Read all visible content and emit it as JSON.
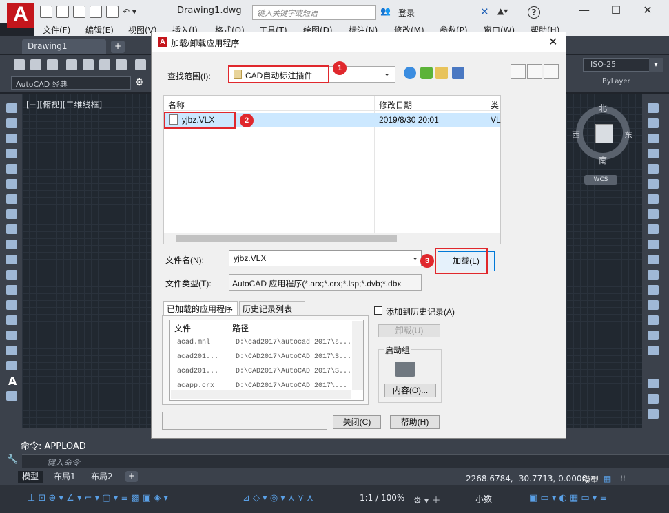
{
  "app": {
    "logo_letter": "A",
    "document_title": "Drawing1.dwg",
    "search_placeholder": "键入关键字或短语",
    "login_label": "登录",
    "help_symbol": "?"
  },
  "menus": [
    "文件(F)",
    "编辑(E)",
    "视图(V)",
    "插入(I)",
    "格式(O)",
    "工具(T)",
    "绘图(D)",
    "标注(N)",
    "修改(M)",
    "参数(P)",
    "窗口(W)",
    "帮助(H)"
  ],
  "tabs": {
    "drawing": "Drawing1",
    "add": "+"
  },
  "workspace": {
    "selected": "AutoCAD 经典"
  },
  "annotation_scale": {
    "selected": "ISO-25"
  },
  "linetype": {
    "selected": "ByLayer"
  },
  "viewport_label": "[−][俯视][二维线框]",
  "viewcube": {
    "north": "北",
    "south": "南",
    "east": "东",
    "west": "西",
    "ucs": "WCS"
  },
  "command": {
    "history": "命令: APPLOAD",
    "prompt_placeholder": "键入命令"
  },
  "layout_tabs": [
    "模型",
    "布局1",
    "布局2"
  ],
  "status": {
    "coordinates": "2268.6784, -30.7713, 0.0000",
    "model_label": "模型",
    "scale": "1:1 / 100%",
    "units": "小数"
  },
  "dialog": {
    "title": "加载/卸载应用程序",
    "look_in_label": "查找范围(I):",
    "look_in_value": "CAD自动标注插件",
    "columns": [
      "名称",
      "修改日期",
      "类"
    ],
    "files": [
      {
        "name": "yjbz.VLX",
        "date": "2019/8/30 20:01",
        "type": "VL"
      }
    ],
    "file_name_label": "文件名(N):",
    "file_name_value": "yjbz.VLX",
    "file_type_label": "文件类型(T):",
    "file_type_value": "AutoCAD 应用程序(*.arx;*.crx;*.lsp;*.dvb;*.dbx",
    "load_button": "加载(L)",
    "tabs": [
      "已加载的应用程序",
      "历史记录列表"
    ],
    "loaded_columns": [
      "文件",
      "路径"
    ],
    "loaded_apps": [
      {
        "file": "acad.mnl",
        "path": "D:\\cad2017\\autocad 2017\\s..."
      },
      {
        "file": "acad201...",
        "path": "D:\\CAD2017\\AutoCAD 2017\\S..."
      },
      {
        "file": "acad201...",
        "path": "D:\\CAD2017\\AutoCAD 2017\\S..."
      },
      {
        "file": "acapp.crx",
        "path": "D:\\CAD2017\\AutoCAD 2017\\..."
      }
    ],
    "add_history_label": "添加到历史记录(A)",
    "unload_button": "卸载(U)",
    "startup_group_label": "启动组",
    "contents_button": "内容(O)...",
    "close_button": "关闭(C)",
    "help_button": "帮助(H)",
    "close_x": "✕"
  },
  "markers": [
    "1",
    "2",
    "3"
  ],
  "colors": {
    "accent_red": "#e0282d",
    "brand_red": "#c4161c",
    "selection_blue": "#cce8ff"
  }
}
